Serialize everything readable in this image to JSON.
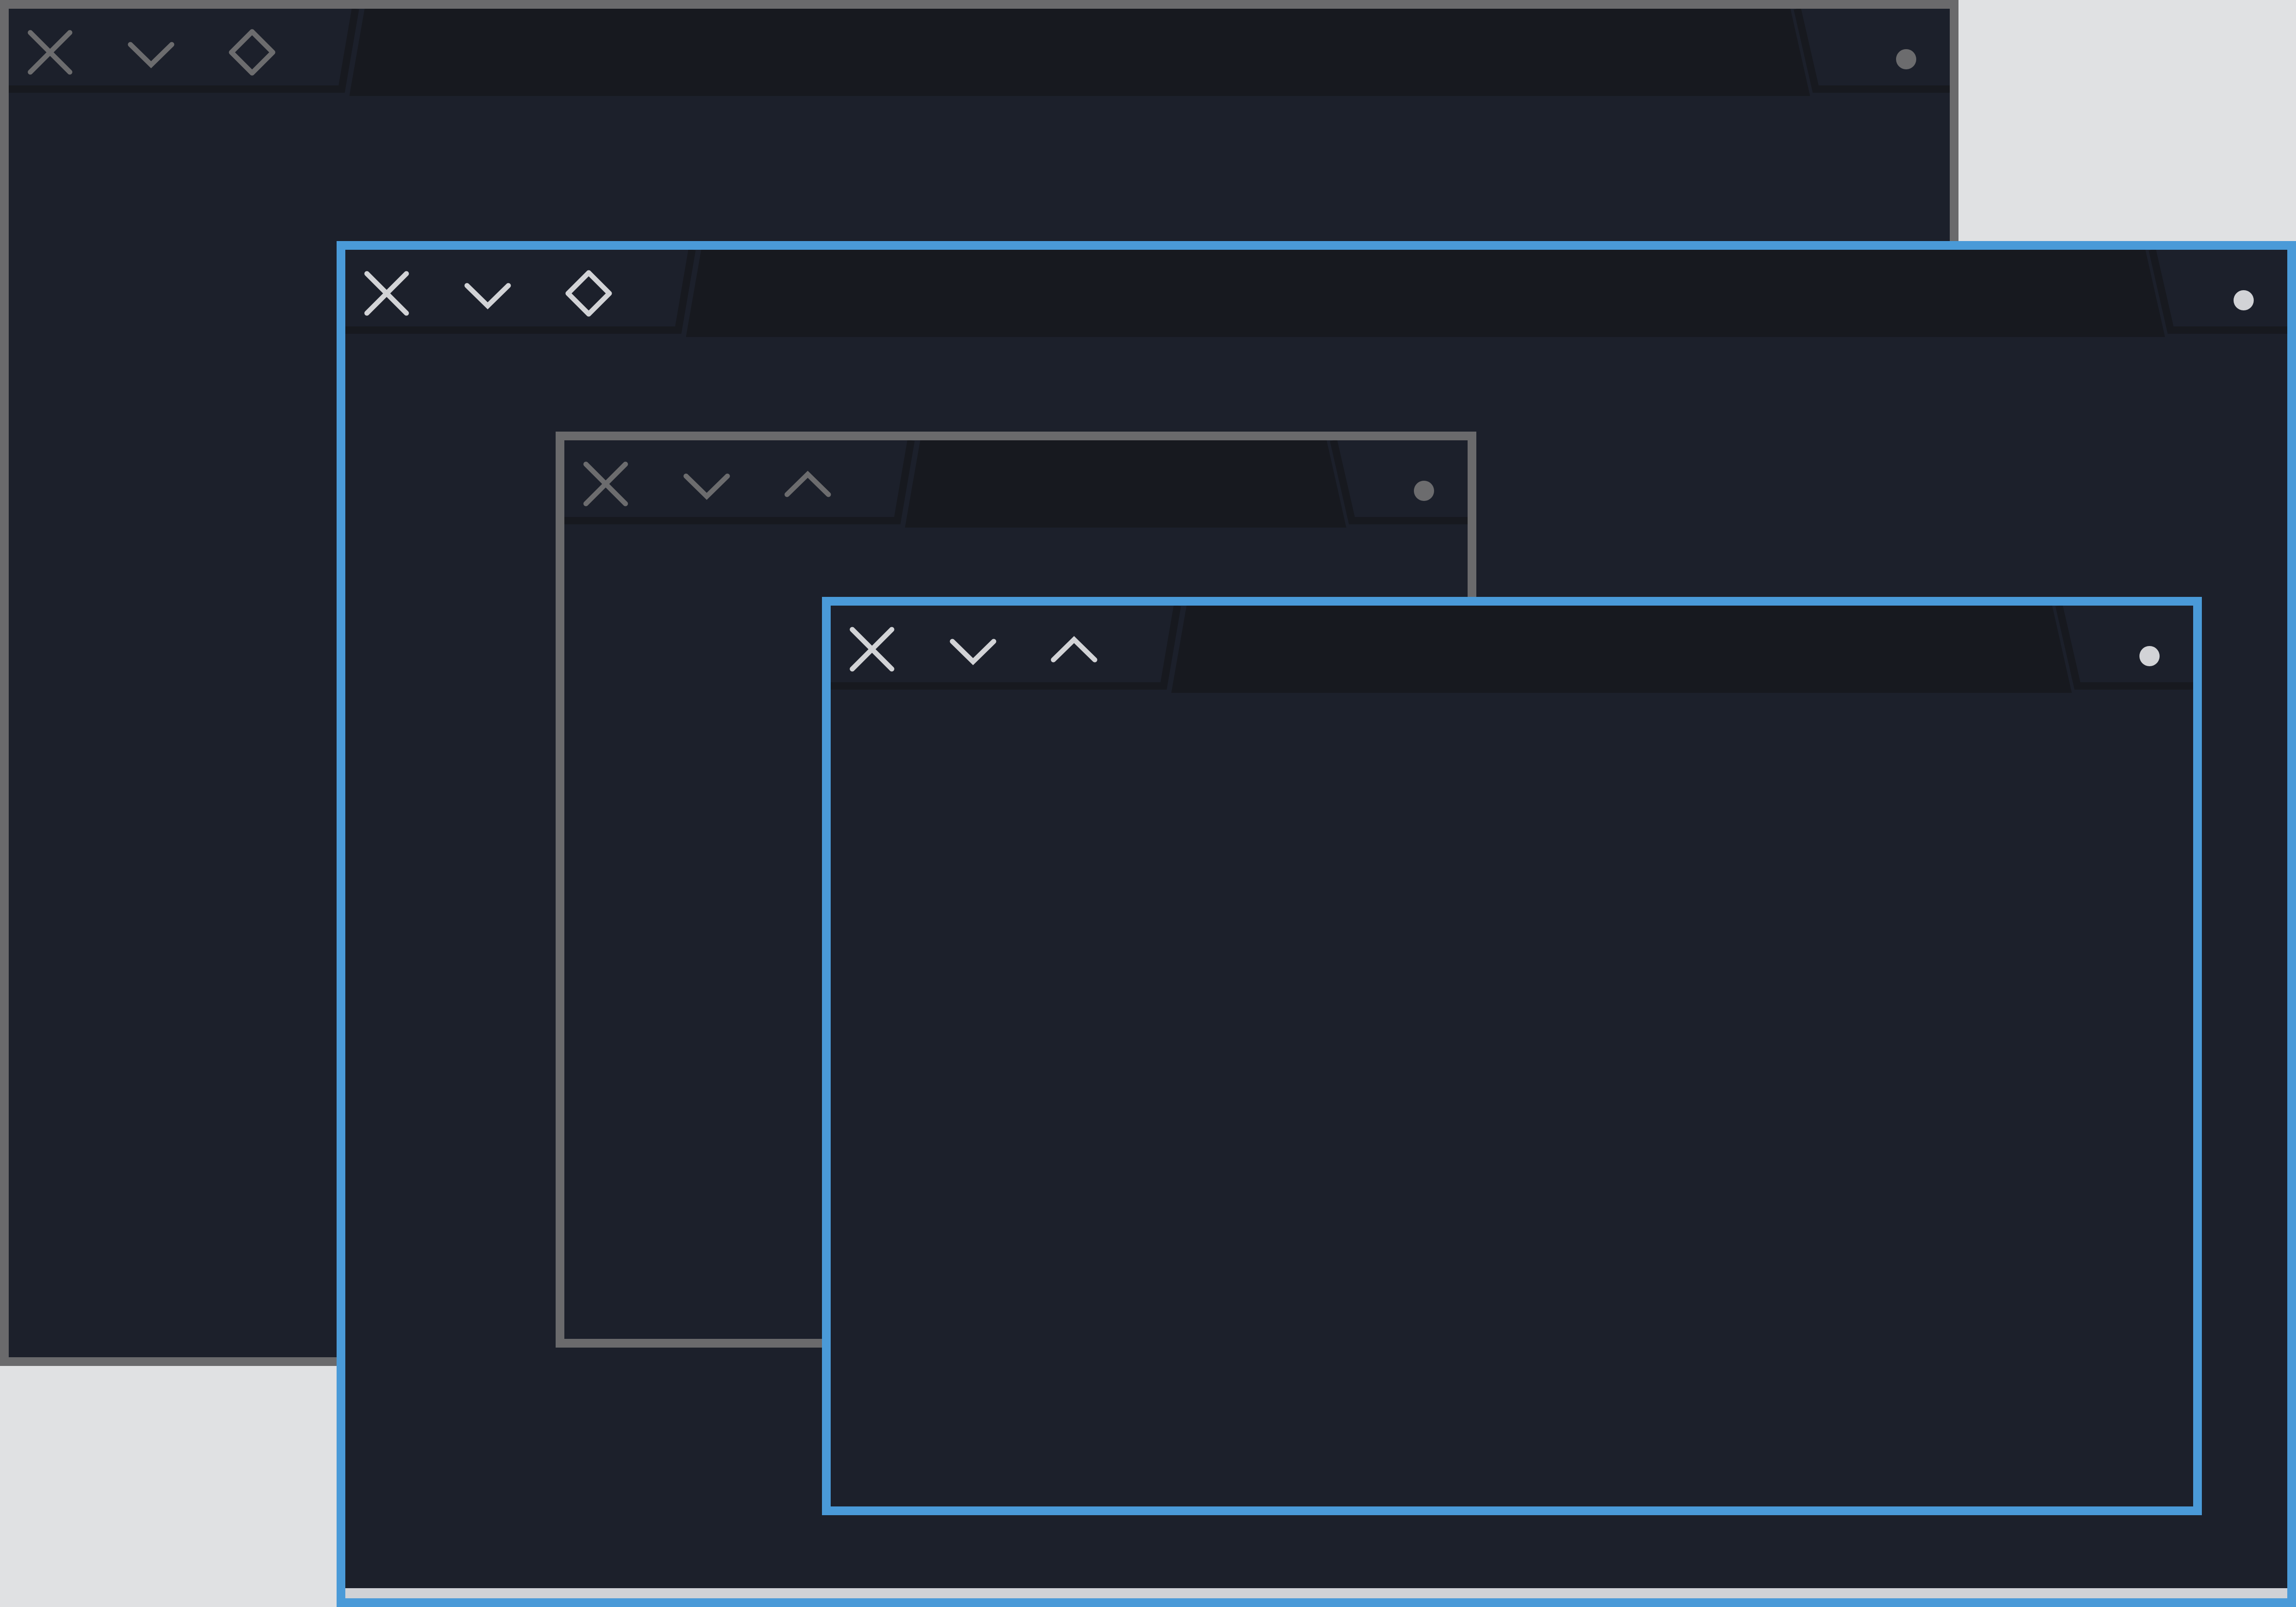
{
  "colors": {
    "desktop_background": "#e0e1e3",
    "window_background": "#1c202b",
    "titlebar_tab_background": "#17191f",
    "inactive_border": "#6a6a6c",
    "active_border": "#4a9ad8",
    "inactive_icon": "#6c6c6e",
    "active_icon": "#d2d3d6"
  },
  "windows": [
    {
      "id": "back-window",
      "state": "inactive",
      "title": "",
      "buttons": [
        "close-icon",
        "minimize-chevron-down-icon",
        "diamond-icon",
        "menu-dot-icon"
      ]
    },
    {
      "id": "large-window",
      "state": "active",
      "title": "",
      "buttons": [
        "close-icon",
        "minimize-chevron-down-icon",
        "diamond-icon",
        "menu-dot-icon"
      ]
    },
    {
      "id": "middle-window",
      "state": "inactive",
      "title": "",
      "buttons": [
        "close-icon",
        "minimize-chevron-down-icon",
        "maximize-chevron-up-icon",
        "menu-dot-icon"
      ]
    },
    {
      "id": "front-window",
      "state": "active",
      "title": "",
      "buttons": [
        "close-icon",
        "minimize-chevron-down-icon",
        "maximize-chevron-up-icon",
        "menu-dot-icon"
      ]
    }
  ]
}
